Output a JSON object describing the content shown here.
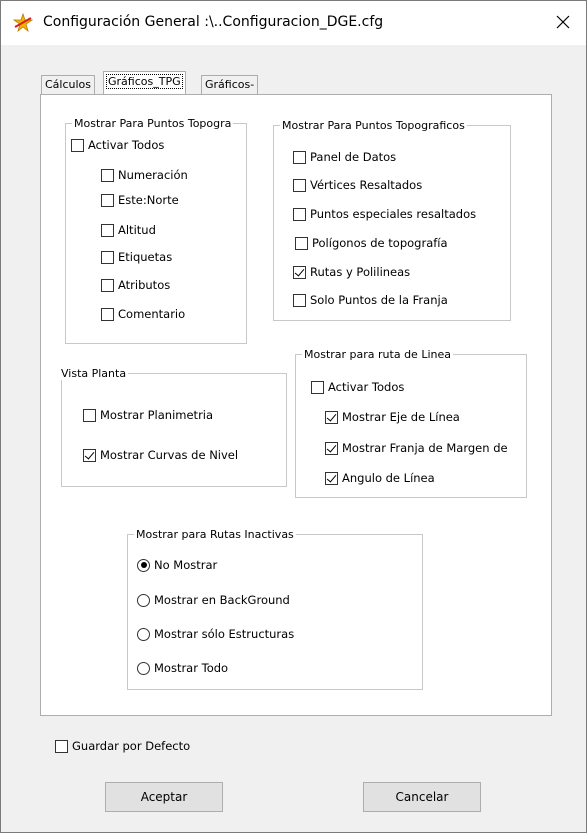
{
  "window": {
    "title": "Configuración General :\\..Configuracion_DGE.cfg",
    "close_symbol": "✕"
  },
  "tabs": [
    {
      "label": "Cálculos",
      "active": false
    },
    {
      "label": "Gráficos_TPG",
      "active": true
    },
    {
      "label": "Gráficos-Diseño",
      "active": false
    }
  ],
  "group_puntos_left": {
    "title": "Mostrar Para Puntos Topogra",
    "activar_todos": {
      "label": "Activar Todos",
      "checked": false
    },
    "items": [
      {
        "label": "Numeración",
        "checked": false
      },
      {
        "label": "Este:Norte",
        "checked": false
      },
      {
        "label": "Altitud",
        "checked": false
      },
      {
        "label": "Etiquetas",
        "checked": false
      },
      {
        "label": "Atributos",
        "checked": false
      },
      {
        "label": "Comentario",
        "checked": false
      }
    ]
  },
  "group_puntos_right": {
    "title": "Mostrar Para Puntos Topograficos",
    "items": [
      {
        "label": "Panel de Datos",
        "checked": false
      },
      {
        "label": "Vértices Resaltados",
        "checked": false
      },
      {
        "label": "Puntos especiales resaltados",
        "checked": false
      },
      {
        "label": "Polígonos de topografía",
        "checked": false
      },
      {
        "label": "Rutas y Polilineas",
        "checked": true
      },
      {
        "label": "Solo Puntos de la Franja",
        "checked": false
      }
    ]
  },
  "group_vista_planta": {
    "title": "Vista Planta",
    "items": [
      {
        "label": "Mostrar Planimetria",
        "checked": false
      },
      {
        "label": "Mostrar Curvas de Nivel",
        "checked": true
      }
    ]
  },
  "group_ruta_linea": {
    "title": "Mostrar para ruta de Linea",
    "activar_todos": {
      "label": "Activar Todos",
      "checked": false
    },
    "items": [
      {
        "label": "Mostrar Eje de Línea",
        "checked": true
      },
      {
        "label": "Mostrar Franja de Margen de",
        "checked": true
      },
      {
        "label": "Angulo de Línea",
        "checked": true
      }
    ]
  },
  "group_rutas_inactivas": {
    "title": "Mostrar para Rutas Inactivas",
    "options": [
      {
        "label": "No Mostrar",
        "selected": true
      },
      {
        "label": "Mostrar en BackGround",
        "selected": false
      },
      {
        "label": "Mostrar sólo Estructuras",
        "selected": false
      },
      {
        "label": "Mostrar Todo",
        "selected": false
      }
    ]
  },
  "footer": {
    "guardar_por_defecto": {
      "label": "Guardar por Defecto",
      "checked": false
    },
    "accept_label": "Aceptar",
    "cancel_label": "Cancelar"
  }
}
